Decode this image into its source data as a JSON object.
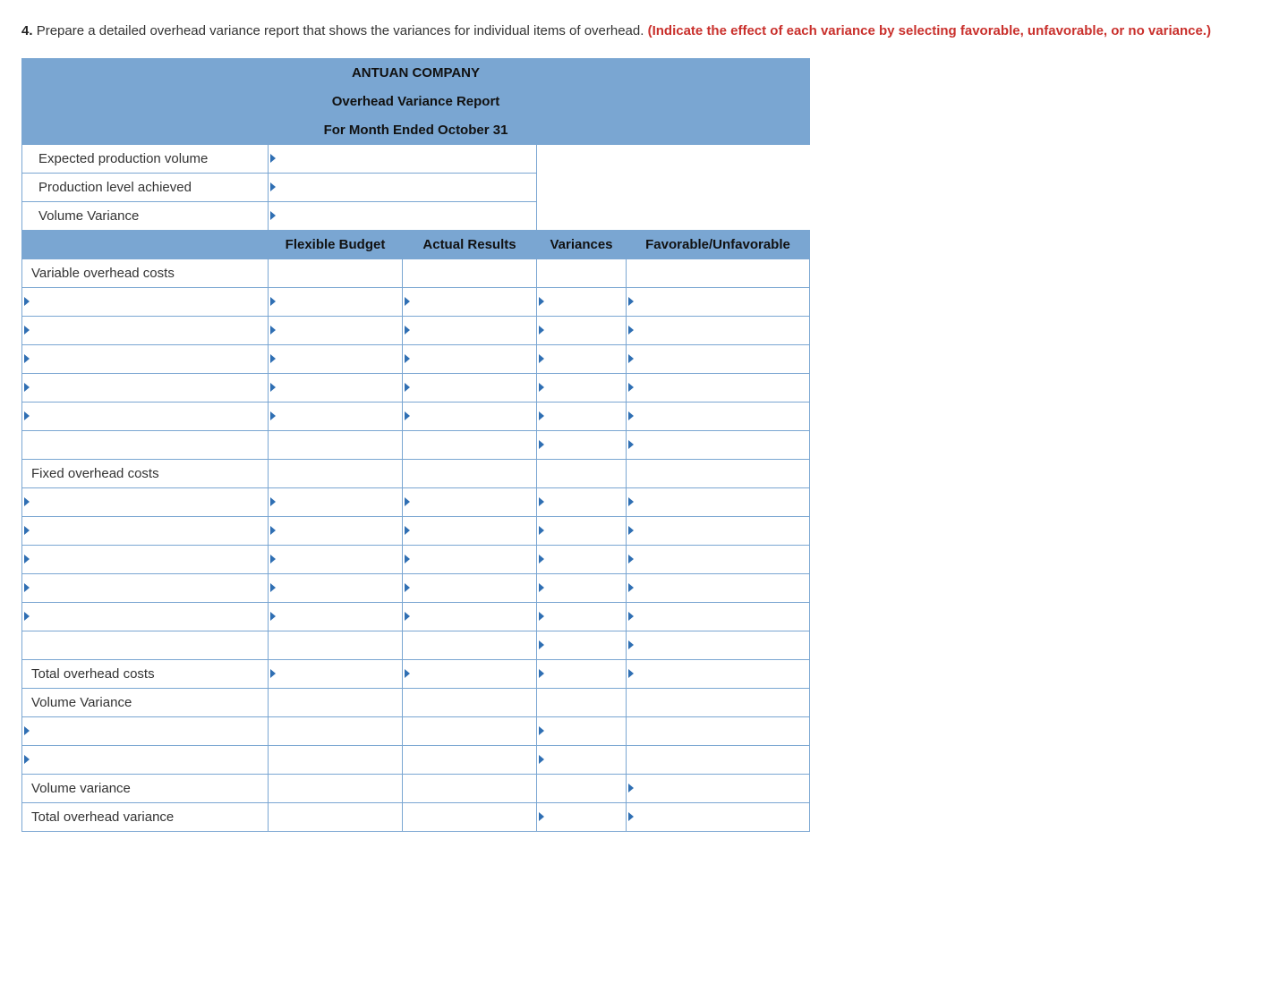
{
  "question": {
    "number": "4.",
    "text": "Prepare a detailed overhead variance report that shows the variances for individual items of overhead.",
    "emph": "(Indicate the effect of each variance by selecting favorable, unfavorable, or no variance.)"
  },
  "report": {
    "company": "ANTUAN COMPANY",
    "title": "Overhead Variance Report",
    "period": "For Month Ended October 31",
    "top_rows": [
      "Expected production volume",
      "Production level achieved",
      "Volume Variance"
    ],
    "columns": {
      "flex": "Flexible Budget",
      "actual": "Actual Results",
      "var": "Variances",
      "fav": "Favorable/Unfavorable"
    },
    "sections": {
      "variable_label": "Variable overhead costs",
      "fixed_label": "Fixed overhead costs",
      "total_overhead": "Total overhead costs",
      "volume_variance": "Volume Variance",
      "volume_variance_lower": "Volume variance",
      "total_overhead_variance": "Total overhead variance"
    }
  }
}
